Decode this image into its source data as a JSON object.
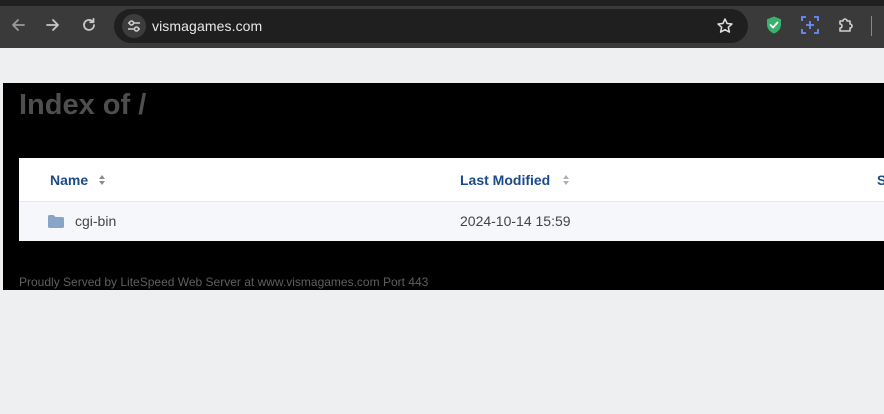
{
  "browser": {
    "url": "vismagames.com",
    "icons": {
      "back": "arrow-left-icon",
      "forward": "arrow-right-icon",
      "reload": "reload-icon",
      "site_info": "tune-icon",
      "bookmark": "star-icon",
      "ext1": "shield-check-icon",
      "ext2": "screen-capture-icon",
      "extensions": "puzzle-icon"
    },
    "colors": {
      "chrome_bg": "#3a3a3a",
      "omnibox_bg": "#1f1f1f",
      "shield": "#39b36b",
      "capture": "#6b8cff"
    }
  },
  "page": {
    "title": "Index of /",
    "table": {
      "columns": [
        "Name",
        "Last Modified",
        "S"
      ],
      "rows": [
        {
          "name": "cgi-bin",
          "modified": "2024-10-14 15:59",
          "icon": "folder-icon"
        }
      ]
    },
    "footer": "Proudly Served by LiteSpeed Web Server at www.vismagames.com Port 443",
    "colors": {
      "header_link": "#1b4a8a",
      "folder": "#8aa4c8",
      "title": "#4e4e4e"
    }
  }
}
